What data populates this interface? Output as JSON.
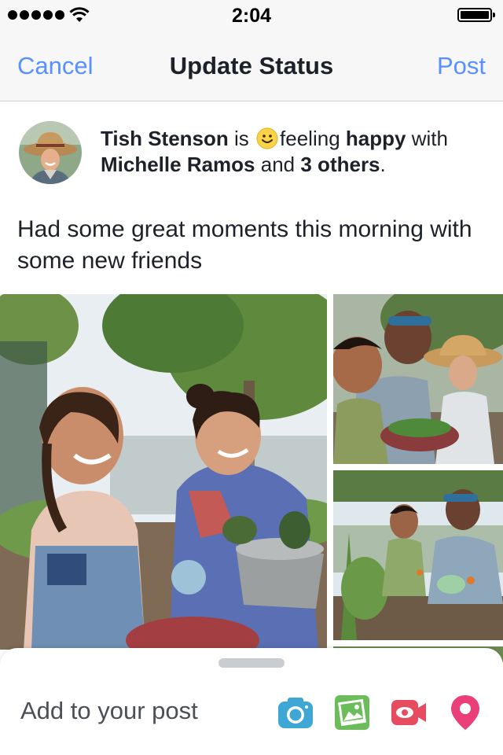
{
  "status_bar": {
    "time": "2:04",
    "signal_icon": "signal-dots-icon",
    "wifi_icon": "wifi-icon",
    "battery_icon": "battery-full-icon"
  },
  "nav": {
    "cancel_label": "Cancel",
    "title": "Update Status",
    "post_label": "Post"
  },
  "composer": {
    "author": "Tish Stenson",
    "is_text": "is",
    "feeling_icon": "smiley-icon",
    "feeling_prefix": "feeling",
    "feeling": "happy",
    "with_text": "with",
    "tagged_friend": "Michelle Ramos",
    "and_text": "and",
    "others": "3 others",
    "period": ".",
    "post_text": "Had some great moments this morning with some new friends"
  },
  "photos": [
    {
      "name": "photo-two-girls-gardening"
    },
    {
      "name": "photo-gardeners-with-hats"
    },
    {
      "name": "photo-boy-and-woman-planting"
    }
  ],
  "add_to_post": {
    "label": "Add to your post",
    "tools": [
      {
        "icon": "camera-icon",
        "color": "#3ea7d5"
      },
      {
        "icon": "photo-icon",
        "color": "#6bbd5b"
      },
      {
        "icon": "video-icon",
        "color": "#e64b5f"
      },
      {
        "icon": "location-pin-icon",
        "color": "#ea3f78"
      }
    ]
  },
  "colors": {
    "accent": "#5890ff",
    "text": "#1d2129",
    "nav_bg": "#f7f7f8"
  }
}
